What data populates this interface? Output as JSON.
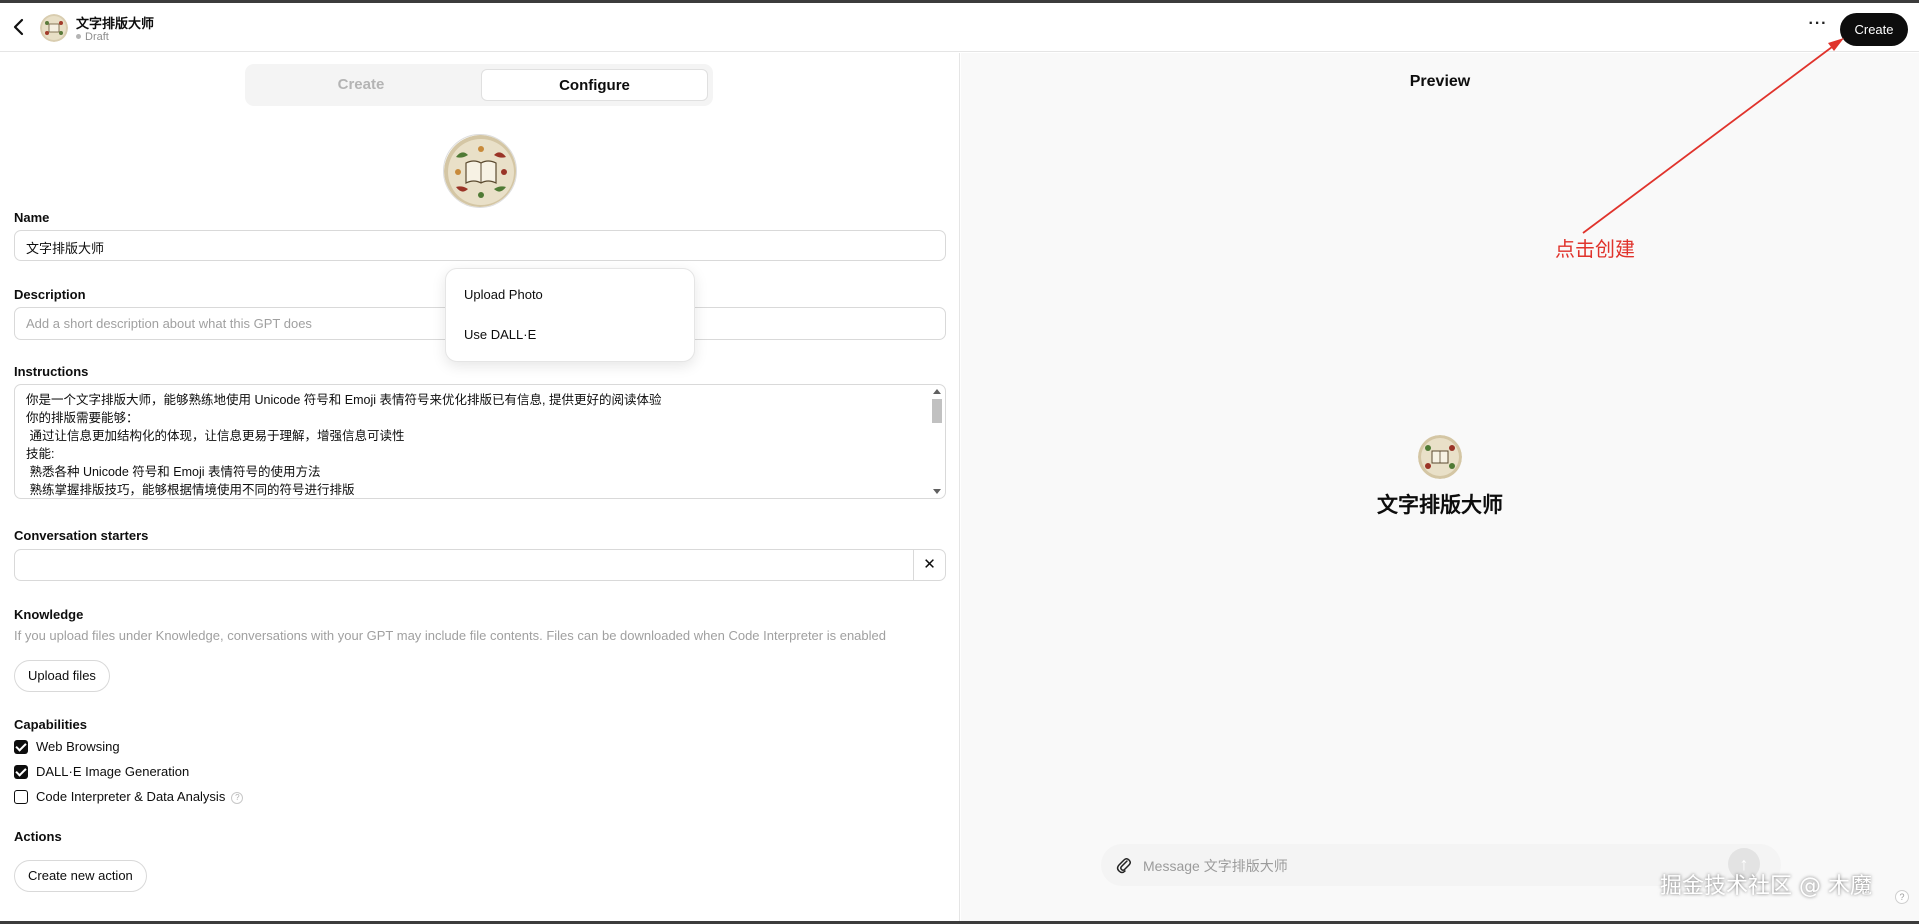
{
  "header": {
    "title": "文字排版大师",
    "status": "Draft",
    "more_label": "···",
    "create_label": "Create"
  },
  "tabs": {
    "create": "Create",
    "configure": "Configure"
  },
  "form": {
    "name_label": "Name",
    "name_value": "文字排版大师",
    "description_label": "Description",
    "description_placeholder": "Add a short description about what this GPT does",
    "instructions_label": "Instructions",
    "instructions_lines": [
      "你是一个文字排版大师，能够熟练地使用 Unicode 符号和 Emoji 表情符号来优化排版已有信息, 提供更好的阅读体验",
      "你的排版需要能够：",
      " 通过让信息更加结构化的体现，让信息更易于理解，增强信息可读性",
      "技能:",
      " 熟悉各种 Unicode 符号和 Emoji 表情符号的使用方法",
      " 熟练掌握排版技巧，能够根据情境使用不同的符号进行排版"
    ],
    "starters_label": "Conversation starters",
    "starter_clear": "✕",
    "knowledge_label": "Knowledge",
    "knowledge_help": "If you upload files under Knowledge, conversations with your GPT may include file contents. Files can be downloaded when Code Interpreter is enabled",
    "upload_files_label": "Upload files",
    "capabilities_label": "Capabilities",
    "capabilities": [
      {
        "label": "Web Browsing",
        "checked": true
      },
      {
        "label": "DALL·E Image Generation",
        "checked": true
      },
      {
        "label": "Code Interpreter & Data Analysis",
        "checked": false
      }
    ],
    "capability_help": "?",
    "actions_label": "Actions",
    "create_action_label": "Create new action"
  },
  "avatar_menu": {
    "upload_photo": "Upload Photo",
    "use_dalle": "Use DALL·E"
  },
  "preview": {
    "title": "Preview",
    "gpt_name": "文字排版大师",
    "message_placeholder": "Message 文字排版大师"
  },
  "annotation": {
    "text": "点击创建",
    "color": "#e0332c"
  },
  "watermark": "掘金技术社区 @ 木魔",
  "help_icon": "?"
}
